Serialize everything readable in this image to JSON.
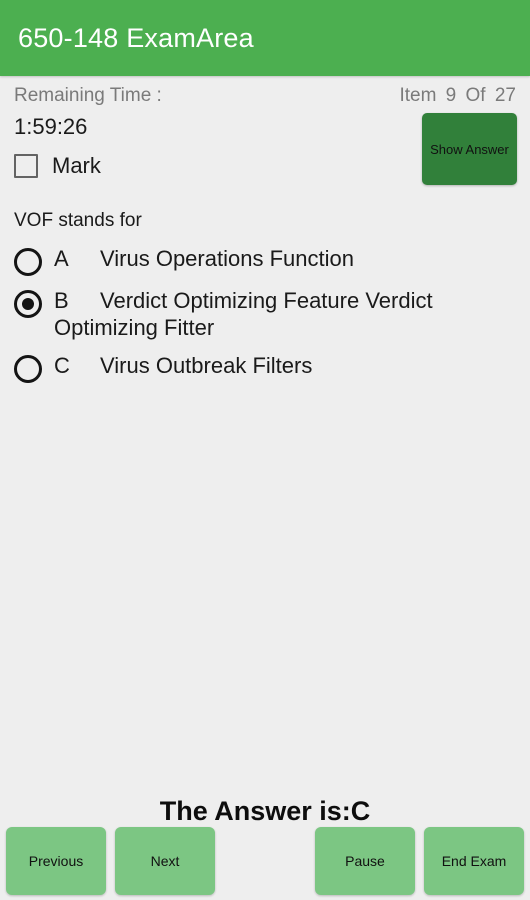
{
  "appbar": {
    "title": "650-148 ExamArea",
    "background": "#4caf50",
    "text_color": "#ffffff"
  },
  "status": {
    "remaining_time_label": "Remaining Time :",
    "item_counter": "Item 9 Of 27",
    "timer_value": "1:59:26",
    "current_item": 9,
    "total_items": 27
  },
  "mark": {
    "label": "Mark",
    "checked": false,
    "icon": "checkbox-unchecked-icon"
  },
  "show_answer": {
    "label": "Show Answer",
    "background": "#31803a"
  },
  "question": {
    "text": "VOF stands for",
    "selected": "B",
    "options": [
      {
        "letter": "A",
        "text": "Virus Operations Function",
        "selected": false,
        "icon": "radio-unchecked-icon"
      },
      {
        "letter": "B",
        "text": "Verdict Optimizing Feature Verdict Optimizing Fitter",
        "selected": true,
        "icon": "radio-checked-icon"
      },
      {
        "letter": "C",
        "text": "Virus Outbreak Filters",
        "selected": false,
        "icon": "radio-unchecked-icon"
      }
    ]
  },
  "answer_reveal": {
    "text": "The Answer is:C"
  },
  "footer": {
    "background": "#7cc683",
    "buttons": [
      {
        "label": "Previous",
        "name": "previous-button"
      },
      {
        "label": "Next",
        "name": "next-button"
      },
      {
        "label": "Pause",
        "name": "pause-button"
      },
      {
        "label": "End Exam",
        "name": "end-exam-button"
      }
    ]
  }
}
